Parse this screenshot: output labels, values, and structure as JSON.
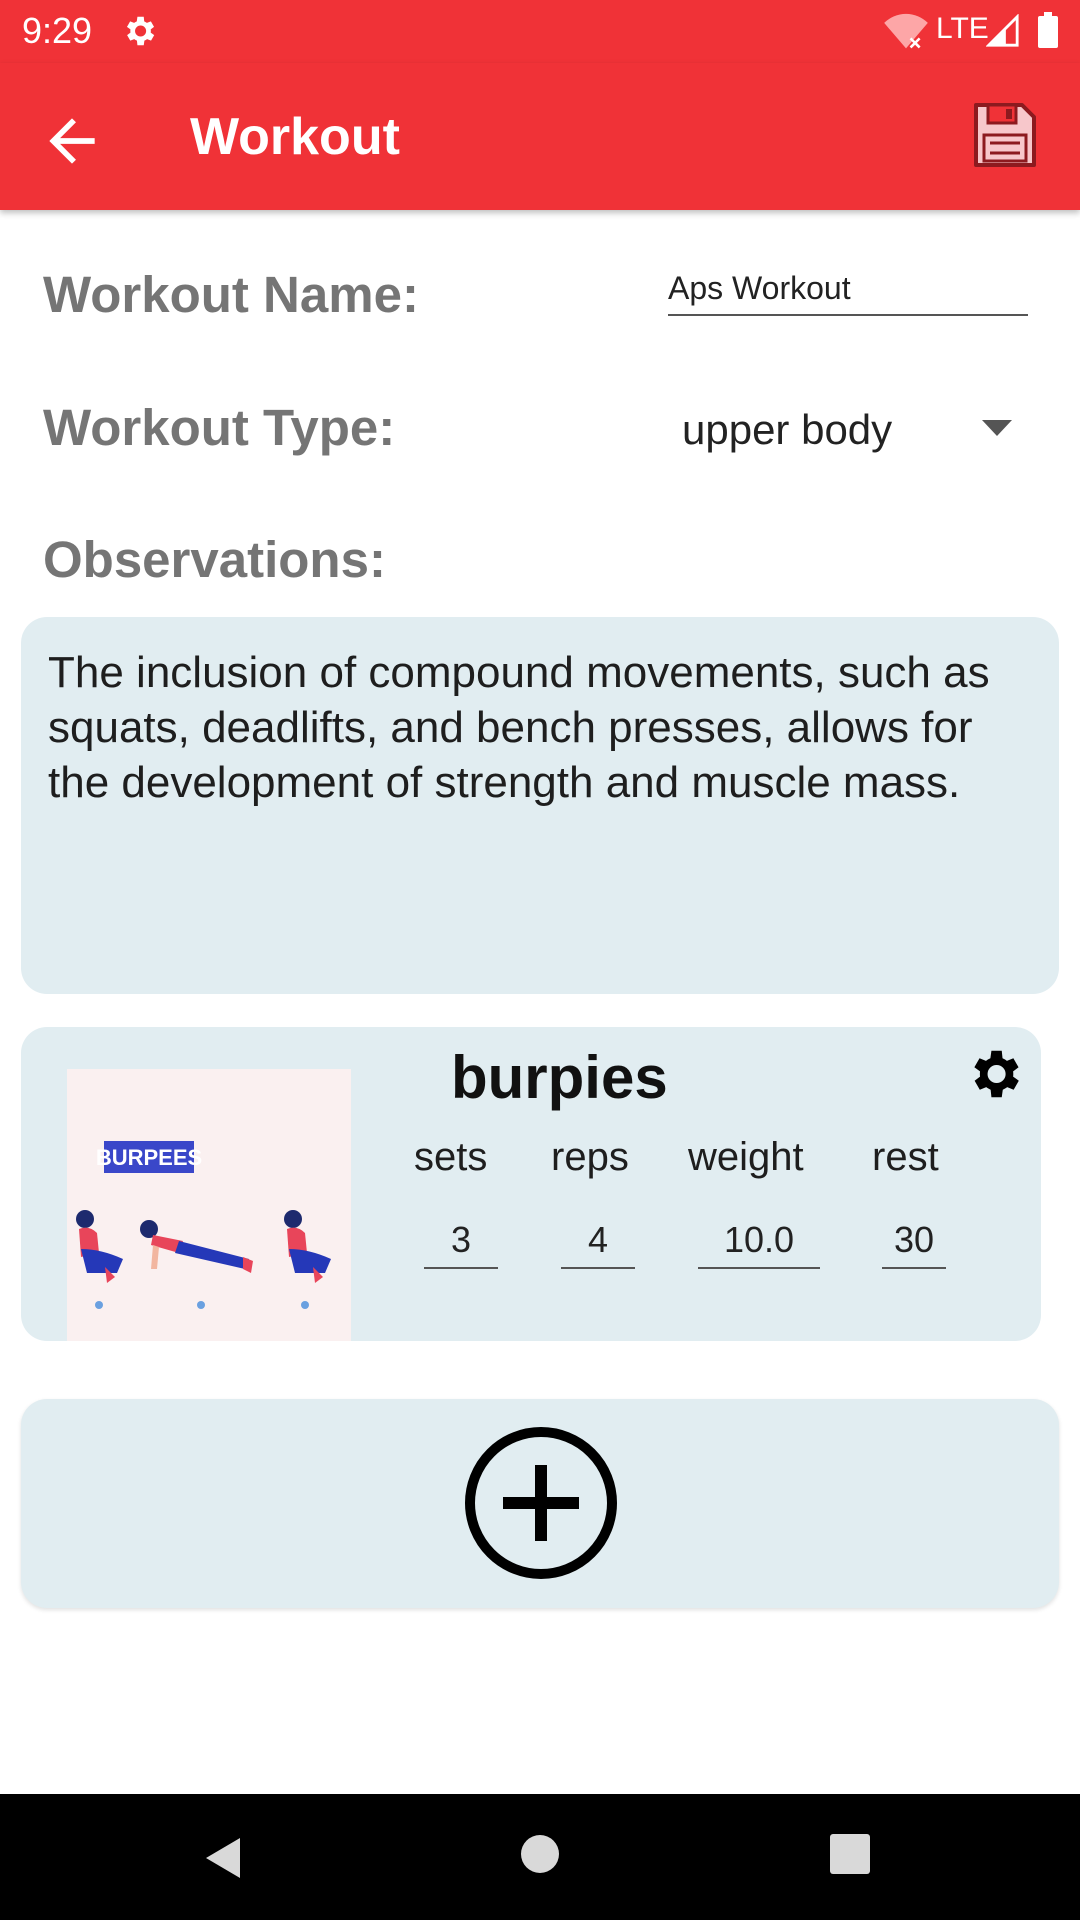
{
  "status_bar": {
    "time": "9:29",
    "network": "LTE",
    "icons": [
      "settings-icon",
      "wifi-off-icon",
      "signal-icon",
      "battery-icon"
    ]
  },
  "app_bar": {
    "title": "Workout",
    "back_icon": "arrow-back-icon",
    "save_icon": "floppy-disk-icon",
    "color": "#f03237"
  },
  "form": {
    "name_label": "Workout Name:",
    "name_value": "Aps Workout",
    "type_label": "Workout Type:",
    "type_value": "upper body",
    "observations_label": "Observations:",
    "observations_text": "The inclusion of compound movements, such as squats, deadlifts, and bench presses, allows for the development of strength and muscle mass."
  },
  "exercises": [
    {
      "name": "burpies",
      "image_caption": "BURPEES",
      "columns": [
        "sets",
        "reps",
        "weight",
        "rest"
      ],
      "values": {
        "sets": "3",
        "reps": "4",
        "weight": "10.0",
        "rest": "30"
      }
    }
  ],
  "add_button": {
    "icon": "add-circle-icon"
  },
  "nav_bar": {
    "icons": [
      "nav-back-icon",
      "nav-home-icon",
      "nav-recents-icon"
    ]
  },
  "colors": {
    "accent": "#f03237",
    "card": "#e1edf1",
    "label": "#757575"
  }
}
